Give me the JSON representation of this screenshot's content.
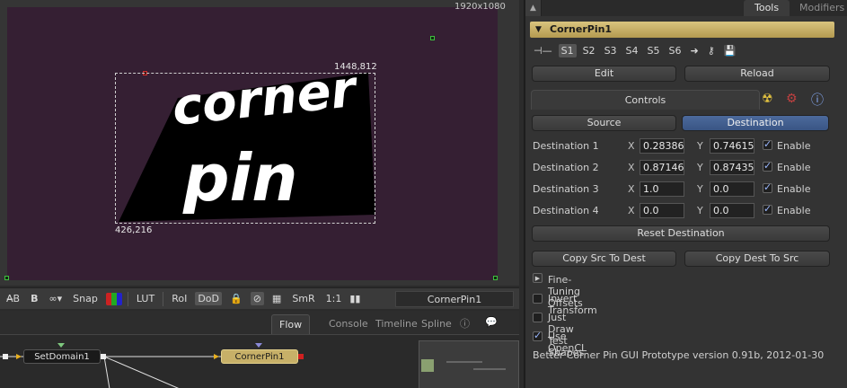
{
  "viewer": {
    "resolution": "1920x1080",
    "top_right_coord": "1448,812",
    "bottom_left_coord": "426,216",
    "title_line1": "corner",
    "title_line2": "pin",
    "toolbar": {
      "snap": "Snap",
      "lut": "LUT",
      "roi": "RoI",
      "dod": "DoD",
      "smr": "SmR",
      "ratio": "1:1",
      "viewer_name": "CornerPin1"
    }
  },
  "flow": {
    "tabs": [
      "Flow",
      "Console",
      "Timeline",
      "Spline"
    ],
    "nodes": {
      "setdomain": "SetDomain1",
      "cornerpin": "CornerPin1"
    }
  },
  "panel": {
    "tabs": {
      "tools": "Tools",
      "modifiers": "Modifiers"
    },
    "tool_name": "CornerPin1",
    "slots": [
      "S1",
      "S2",
      "S3",
      "S4",
      "S5",
      "S6"
    ],
    "buttons": {
      "edit": "Edit",
      "reload": "Reload",
      "controls": "Controls",
      "source": "Source",
      "destination": "Destination",
      "reset_destination": "Reset Destination",
      "copy_src_to_dest": "Copy Src To Dest",
      "copy_dest_to_src": "Copy Dest To Src"
    },
    "axis_x": "X",
    "axis_y": "Y",
    "enable_label": "Enable",
    "destinations": [
      {
        "label": "Destination 1",
        "x": "0.283861",
        "y": "0.746153",
        "enabled": true
      },
      {
        "label": "Destination 2",
        "x": "0.871469",
        "y": "0.874358",
        "enabled": true
      },
      {
        "label": "Destination 3",
        "x": "1.0",
        "y": "0.0",
        "enabled": true
      },
      {
        "label": "Destination 4",
        "x": "0.0",
        "y": "0.0",
        "enabled": true
      }
    ],
    "options": {
      "fine_tuning": "Fine-Tuning Offsets",
      "invert_transform": "Invert Transform",
      "just_draw": "Just Draw Test Shapes",
      "use_opencl": "Use OpenCL"
    },
    "footer": "Better Corner Pin GUI Prototype version 0.91b, 2012-01-30"
  }
}
